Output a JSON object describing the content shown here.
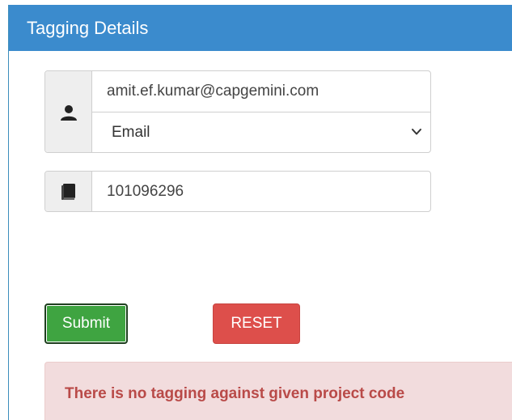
{
  "panel": {
    "title": "Tagging Details"
  },
  "form": {
    "email_value": "amit.ef.kumar@capgemini.com",
    "id_type_selected": "Email",
    "project_code_value": "101096296",
    "icons": {
      "user": "user-icon",
      "book": "book-icon",
      "dropdown": "chevron-down-icon"
    }
  },
  "buttons": {
    "submit_label": "Submit",
    "reset_label": "RESET"
  },
  "alert": {
    "message": "There is no tagging against given project code"
  },
  "colors": {
    "header": "#3b8bcd",
    "submit": "#3fa441",
    "reset": "#dd4f4b",
    "alert_bg": "#f2dcdd",
    "alert_text": "#b94a48"
  }
}
